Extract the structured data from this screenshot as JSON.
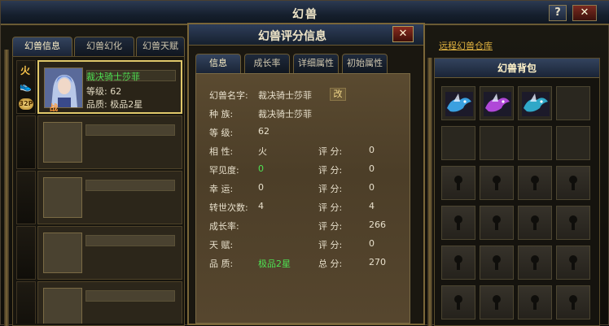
{
  "window": {
    "title": "幻兽",
    "help_label": "?",
    "close_label": "✕"
  },
  "left_tabs": [
    {
      "label": "幻兽信息",
      "active": true
    },
    {
      "label": "幻兽幻化",
      "active": false
    },
    {
      "label": "幻兽天赋",
      "active": false
    }
  ],
  "selected_pet": {
    "element": "火",
    "badge": "32P",
    "battle_mark": "战",
    "name": "裁决骑士莎菲",
    "level_line": "等级:   62",
    "quality_line": "品质:   极品2星"
  },
  "eval": {
    "title": "幻兽评分信息",
    "close_label": "✕",
    "tabs": [
      {
        "label": "信息",
        "active": true
      },
      {
        "label": "成长率",
        "active": false
      },
      {
        "label": "详细属性",
        "active": false
      },
      {
        "label": "初始属性",
        "active": false
      }
    ],
    "rename_label": "改",
    "rows": [
      {
        "label": "幻兽名字:",
        "value": "裁决骑士莎菲",
        "score_label": "",
        "score": ""
      },
      {
        "label": "种    族:",
        "value": "裁决骑士莎菲",
        "score_label": "",
        "score": ""
      },
      {
        "label": "等    级:",
        "value": "62",
        "score_label": "",
        "score": ""
      },
      {
        "label": "相    性:",
        "value": "火",
        "score_label": "评    分:",
        "score": "0"
      },
      {
        "label": "罕见度:",
        "value": "0",
        "score_label": "评    分:",
        "score": "0",
        "value_green": true
      },
      {
        "label": "幸    运:",
        "value": "0",
        "score_label": "评    分:",
        "score": "0"
      },
      {
        "label": "转世次数:",
        "value": "4",
        "score_label": "评    分:",
        "score": "4"
      },
      {
        "label": "成长率:",
        "value": "",
        "score_label": "评    分:",
        "score": "266"
      },
      {
        "label": "天    赋:",
        "value": "",
        "score_label": "评    分:",
        "score": "0"
      },
      {
        "label": "品    质:",
        "value": "极品2星",
        "score_label": "总    分:",
        "score": "270",
        "value_green": true
      }
    ]
  },
  "bag": {
    "remote_link": "远程幻兽仓库",
    "title": "幻兽背包",
    "dragon_colors": [
      "#3aa0e0",
      "#b048d8",
      "#30a8c8"
    ]
  }
}
